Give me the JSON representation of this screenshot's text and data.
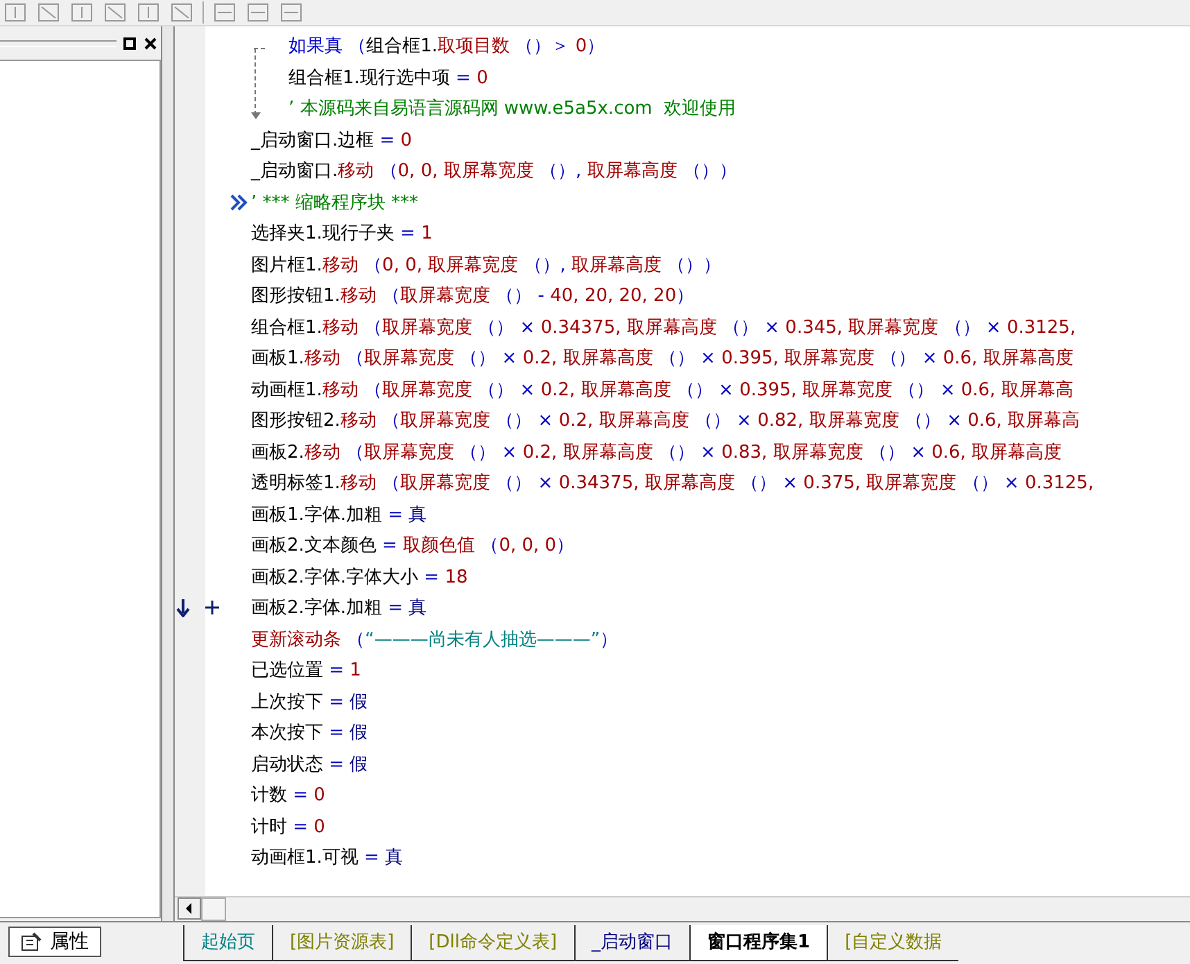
{
  "side_panel": {
    "tab": {
      "label": "属性",
      "selected": true
    }
  },
  "code_lines": [
    {
      "parts": [
        {
          "kind": "kw",
          "text": "如果真"
        },
        {
          "kind": "op",
          "text": " （"
        },
        {
          "kind": "text",
          "text": "组合框1."
        },
        {
          "kind": "fn",
          "text": "取项目数"
        },
        {
          "kind": "op",
          "text": " （）＞ "
        },
        {
          "kind": "num",
          "text": "0"
        },
        {
          "kind": "op",
          "text": "）"
        }
      ],
      "children": [
        {
          "parts": [
            {
              "kind": "text",
              "text": "组合框1.现行选中项 "
            },
            {
              "kind": "op",
              "text": "= "
            },
            {
              "kind": "num",
              "text": "0"
            }
          ]
        },
        {
          "parts": [
            {
              "kind": "comment",
              "text": "’ 本源码来自易语言源码网 www.e5a5x.com  欢迎使用"
            }
          ]
        }
      ]
    },
    {
      "parts": [
        {
          "kind": "text",
          "text": "_启动窗口.边框 "
        },
        {
          "kind": "op",
          "text": "= "
        },
        {
          "kind": "num",
          "text": "0"
        }
      ]
    },
    {
      "parts": [
        {
          "kind": "text",
          "text": "_启动窗口."
        },
        {
          "kind": "fn",
          "text": "移动"
        },
        {
          "kind": "op",
          "text": " （"
        },
        {
          "kind": "num",
          "text": "0, 0, "
        },
        {
          "kind": "fn",
          "text": "取屏幕宽度"
        },
        {
          "kind": "op",
          "text": " （）, "
        },
        {
          "kind": "fn",
          "text": "取屏幕高度"
        },
        {
          "kind": "op",
          "text": " （））"
        }
      ]
    },
    {
      "folded": true,
      "parts": [
        {
          "kind": "comment",
          "text": "’ *** 缩略程序块 ***"
        }
      ]
    },
    {
      "parts": [
        {
          "kind": "text",
          "text": "选择夹1.现行子夹 "
        },
        {
          "kind": "op",
          "text": "= "
        },
        {
          "kind": "num",
          "text": "1"
        }
      ]
    },
    {
      "parts": [
        {
          "kind": "text",
          "text": "图片框1."
        },
        {
          "kind": "fn",
          "text": "移动"
        },
        {
          "kind": "op",
          "text": " （"
        },
        {
          "kind": "num",
          "text": "0, 0, "
        },
        {
          "kind": "fn",
          "text": "取屏幕宽度"
        },
        {
          "kind": "op",
          "text": " （）, "
        },
        {
          "kind": "fn",
          "text": "取屏幕高度"
        },
        {
          "kind": "op",
          "text": " （））"
        }
      ]
    },
    {
      "parts": [
        {
          "kind": "text",
          "text": "图形按钮1."
        },
        {
          "kind": "fn",
          "text": "移动"
        },
        {
          "kind": "op",
          "text": " （"
        },
        {
          "kind": "fn",
          "text": "取屏幕宽度"
        },
        {
          "kind": "op",
          "text": " （） - "
        },
        {
          "kind": "num",
          "text": "40, 20, 20, 20"
        },
        {
          "kind": "op",
          "text": "）"
        }
      ]
    },
    {
      "parts": [
        {
          "kind": "text",
          "text": "组合框1."
        },
        {
          "kind": "fn",
          "text": "移动"
        },
        {
          "kind": "op",
          "text": " （"
        },
        {
          "kind": "fn",
          "text": "取屏幕宽度"
        },
        {
          "kind": "op",
          "text": " （） × "
        },
        {
          "kind": "num",
          "text": "0.34375, "
        },
        {
          "kind": "fn",
          "text": "取屏幕高度"
        },
        {
          "kind": "op",
          "text": " （） × "
        },
        {
          "kind": "num",
          "text": "0.345, "
        },
        {
          "kind": "fn",
          "text": "取屏幕宽度"
        },
        {
          "kind": "op",
          "text": " （） × "
        },
        {
          "kind": "num",
          "text": "0.3125,"
        }
      ]
    },
    {
      "parts": [
        {
          "kind": "text",
          "text": "画板1."
        },
        {
          "kind": "fn",
          "text": "移动"
        },
        {
          "kind": "op",
          "text": " （"
        },
        {
          "kind": "fn",
          "text": "取屏幕宽度"
        },
        {
          "kind": "op",
          "text": " （） × "
        },
        {
          "kind": "num",
          "text": "0.2, "
        },
        {
          "kind": "fn",
          "text": "取屏幕高度"
        },
        {
          "kind": "op",
          "text": " （） × "
        },
        {
          "kind": "num",
          "text": "0.395, "
        },
        {
          "kind": "fn",
          "text": "取屏幕宽度"
        },
        {
          "kind": "op",
          "text": " （） × "
        },
        {
          "kind": "num",
          "text": "0.6, "
        },
        {
          "kind": "fn",
          "text": "取屏幕高度"
        }
      ]
    },
    {
      "parts": [
        {
          "kind": "text",
          "text": "动画框1."
        },
        {
          "kind": "fn",
          "text": "移动"
        },
        {
          "kind": "op",
          "text": " （"
        },
        {
          "kind": "fn",
          "text": "取屏幕宽度"
        },
        {
          "kind": "op",
          "text": " （） × "
        },
        {
          "kind": "num",
          "text": "0.2, "
        },
        {
          "kind": "fn",
          "text": "取屏幕高度"
        },
        {
          "kind": "op",
          "text": " （） × "
        },
        {
          "kind": "num",
          "text": "0.395, "
        },
        {
          "kind": "fn",
          "text": "取屏幕宽度"
        },
        {
          "kind": "op",
          "text": " （） × "
        },
        {
          "kind": "num",
          "text": "0.6, "
        },
        {
          "kind": "fn",
          "text": "取屏幕高"
        }
      ]
    },
    {
      "parts": [
        {
          "kind": "text",
          "text": "图形按钮2."
        },
        {
          "kind": "fn",
          "text": "移动"
        },
        {
          "kind": "op",
          "text": " （"
        },
        {
          "kind": "fn",
          "text": "取屏幕宽度"
        },
        {
          "kind": "op",
          "text": " （） × "
        },
        {
          "kind": "num",
          "text": "0.2, "
        },
        {
          "kind": "fn",
          "text": "取屏幕高度"
        },
        {
          "kind": "op",
          "text": " （） × "
        },
        {
          "kind": "num",
          "text": "0.82, "
        },
        {
          "kind": "fn",
          "text": "取屏幕宽度"
        },
        {
          "kind": "op",
          "text": " （） × "
        },
        {
          "kind": "num",
          "text": "0.6, "
        },
        {
          "kind": "fn",
          "text": "取屏幕高"
        }
      ]
    },
    {
      "parts": [
        {
          "kind": "text",
          "text": "画板2."
        },
        {
          "kind": "fn",
          "text": "移动"
        },
        {
          "kind": "op",
          "text": " （"
        },
        {
          "kind": "fn",
          "text": "取屏幕宽度"
        },
        {
          "kind": "op",
          "text": " （） × "
        },
        {
          "kind": "num",
          "text": "0.2, "
        },
        {
          "kind": "fn",
          "text": "取屏幕高度"
        },
        {
          "kind": "op",
          "text": " （） × "
        },
        {
          "kind": "num",
          "text": "0.83, "
        },
        {
          "kind": "fn",
          "text": "取屏幕宽度"
        },
        {
          "kind": "op",
          "text": " （） × "
        },
        {
          "kind": "num",
          "text": "0.6, "
        },
        {
          "kind": "fn",
          "text": "取屏幕高度"
        }
      ]
    },
    {
      "parts": [
        {
          "kind": "text",
          "text": "透明标签1."
        },
        {
          "kind": "fn",
          "text": "移动"
        },
        {
          "kind": "op",
          "text": " （"
        },
        {
          "kind": "fn",
          "text": "取屏幕宽度"
        },
        {
          "kind": "op",
          "text": " （） × "
        },
        {
          "kind": "num",
          "text": "0.34375, "
        },
        {
          "kind": "fn",
          "text": "取屏幕高度"
        },
        {
          "kind": "op",
          "text": " （） × "
        },
        {
          "kind": "num",
          "text": "0.375, "
        },
        {
          "kind": "fn",
          "text": "取屏幕宽度"
        },
        {
          "kind": "op",
          "text": " （） × "
        },
        {
          "kind": "num",
          "text": "0.3125,"
        }
      ]
    },
    {
      "parts": [
        {
          "kind": "text",
          "text": "画板1.字体.加粗 "
        },
        {
          "kind": "op",
          "text": "= "
        },
        {
          "kind": "const",
          "text": "真"
        }
      ]
    },
    {
      "parts": [
        {
          "kind": "text",
          "text": "画板2.文本颜色 "
        },
        {
          "kind": "op",
          "text": "= "
        },
        {
          "kind": "fn",
          "text": "取颜色值"
        },
        {
          "kind": "op",
          "text": " （"
        },
        {
          "kind": "num",
          "text": "0, 0, 0"
        },
        {
          "kind": "op",
          "text": "）"
        }
      ]
    },
    {
      "parts": [
        {
          "kind": "text",
          "text": "画板2.字体.字体大小 "
        },
        {
          "kind": "op",
          "text": "= "
        },
        {
          "kind": "num",
          "text": "18"
        }
      ]
    },
    {
      "current_line": true,
      "parts": [
        {
          "kind": "text",
          "text": "画板2.字体.加粗 "
        },
        {
          "kind": "op",
          "text": "= "
        },
        {
          "kind": "const",
          "text": "真"
        }
      ]
    },
    {
      "parts": [
        {
          "kind": "fn",
          "text": "更新滚动条"
        },
        {
          "kind": "op",
          "text": " （"
        },
        {
          "kind": "string",
          "text": "“———尚未有人抽选———”"
        },
        {
          "kind": "op",
          "text": "）"
        }
      ]
    },
    {
      "parts": [
        {
          "kind": "text",
          "text": "已选位置 "
        },
        {
          "kind": "op",
          "text": "= "
        },
        {
          "kind": "num",
          "text": "1"
        }
      ]
    },
    {
      "parts": [
        {
          "kind": "text",
          "text": "上次按下 "
        },
        {
          "kind": "op",
          "text": "= "
        },
        {
          "kind": "const",
          "text": "假"
        }
      ]
    },
    {
      "parts": [
        {
          "kind": "text",
          "text": "本次按下 "
        },
        {
          "kind": "op",
          "text": "= "
        },
        {
          "kind": "const",
          "text": "假"
        }
      ]
    },
    {
      "parts": [
        {
          "kind": "text",
          "text": "启动状态 "
        },
        {
          "kind": "op",
          "text": "= "
        },
        {
          "kind": "const",
          "text": "假"
        }
      ]
    },
    {
      "parts": [
        {
          "kind": "text",
          "text": "计数 "
        },
        {
          "kind": "op",
          "text": "= "
        },
        {
          "kind": "num",
          "text": "0"
        }
      ]
    },
    {
      "parts": [
        {
          "kind": "text",
          "text": "计时 "
        },
        {
          "kind": "op",
          "text": "= "
        },
        {
          "kind": "num",
          "text": "0"
        }
      ]
    },
    {
      "parts": [
        {
          "kind": "text",
          "text": "动画框1.可视 "
        },
        {
          "kind": "op",
          "text": "= "
        },
        {
          "kind": "const",
          "text": "真"
        }
      ]
    }
  ],
  "bottom_tabs": [
    {
      "label": "起始页",
      "selected": false,
      "color": "#008080"
    },
    {
      "label": "[图片资源表]",
      "selected": false,
      "color": "#808000"
    },
    {
      "label": "[Dll命令定义表]",
      "selected": false,
      "color": "#808000"
    },
    {
      "label": "_启动窗口",
      "selected": false,
      "color": "#000080"
    },
    {
      "label": "窗口程序集1",
      "selected": true,
      "color": "#000000"
    },
    {
      "label": "[自定义数据",
      "selected": false,
      "color": "#808000"
    }
  ]
}
